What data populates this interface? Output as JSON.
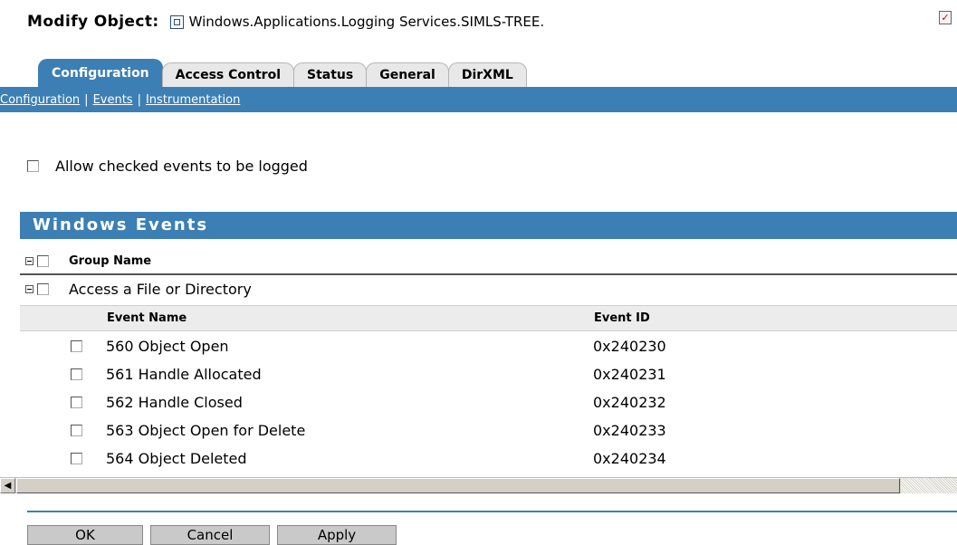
{
  "header": {
    "label": "Modify Object:",
    "object_name": "Windows.Applications.Logging Services.SIMLS-TREE."
  },
  "tabs": [
    {
      "label": "Configuration",
      "active": true
    },
    {
      "label": "Access Control",
      "active": false
    },
    {
      "label": "Status",
      "active": false
    },
    {
      "label": "General",
      "active": false
    },
    {
      "label": "DirXML",
      "active": false
    }
  ],
  "subnav": {
    "configuration": "Configuration",
    "separator": "|",
    "events": "Events",
    "instrumentation": "Instrumentation"
  },
  "allow_checkbox": {
    "label": "Allow checked events to be logged",
    "checked": false
  },
  "panel": {
    "title": "Windows Events"
  },
  "group_table": {
    "header": "Group Name",
    "group": "Access a File or Directory"
  },
  "event_table": {
    "col_name": "Event Name",
    "col_id": "Event ID",
    "rows": [
      {
        "name": "560 Object Open",
        "id": "0x240230"
      },
      {
        "name": "561 Handle Allocated",
        "id": "0x240231"
      },
      {
        "name": "562 Handle Closed",
        "id": "0x240232"
      },
      {
        "name": "563 Object Open for Delete",
        "id": "0x240233"
      },
      {
        "name": "564 Object Deleted",
        "id": "0x240234"
      }
    ]
  },
  "buttons": {
    "ok": "OK",
    "cancel": "Cancel",
    "apply": "Apply"
  },
  "colors": {
    "accent": "#3c7fb4"
  },
  "icons": {
    "object": "object-icon",
    "corner": "edit-checklist-icon",
    "scroll_left": "scroll-left-arrow-icon"
  }
}
